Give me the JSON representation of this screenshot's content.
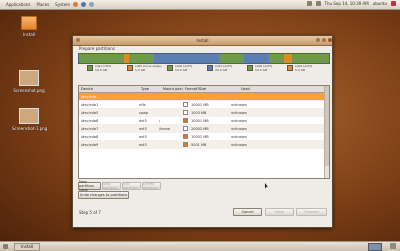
{
  "panel": {
    "menus": [
      "Applications",
      "Places",
      "System"
    ],
    "clock": "Thu Sep 14, 10:39 AM",
    "user": "ubuntu",
    "taskbar_item": "Install"
  },
  "desktop": {
    "icons": [
      {
        "label": "Install"
      },
      {
        "label": "Screenshot.png"
      },
      {
        "label": "Screenshot-1.png"
      }
    ]
  },
  "window": {
    "title": "Install",
    "section_label": "Prepare partitions",
    "partition_bar": {
      "segments": [
        {
          "color": "#6f9a4a",
          "fraction": 0.18
        },
        {
          "color": "#e08a2c",
          "fraction": 0.02
        },
        {
          "color": "#6f9a4a",
          "fraction": 0.1
        },
        {
          "color": "#5b7fb3",
          "fraction": 0.26
        },
        {
          "color": "#6f9a4a",
          "fraction": 0.1
        },
        {
          "color": "#5b7fb3",
          "fraction": 0.1
        },
        {
          "color": "#6f9a4a",
          "fraction": 0.06
        },
        {
          "color": "#e08a2c",
          "fraction": 0.03
        },
        {
          "color": "#6f9a4a",
          "fraction": 0.15
        }
      ]
    },
    "legend": [
      {
        "color": "#6f9a4a",
        "label": "sda1 (ntfs)",
        "size": "10.0 GB"
      },
      {
        "color": "#e08a2c",
        "label": "sda5 (linux-swap)",
        "size": "1.0 GB"
      },
      {
        "color": "#6f9a4a",
        "label": "sda6 (ext3)",
        "size": "10.0 GB"
      },
      {
        "color": "#5b7fb3",
        "label": "sda7 (ext3)",
        "size": "20.0 GB"
      },
      {
        "color": "#6f9a4a",
        "label": "sda8 (ext3)",
        "size": "10.0 GB"
      },
      {
        "color": "#e08a2c",
        "label": "sda9 (ext3)",
        "size": "5.0 GB"
      }
    ],
    "columns": [
      "Device",
      "Type",
      "Mount point",
      "Format?",
      "Size",
      "Used"
    ],
    "rows": [
      {
        "device": "/dev/sda",
        "type": "",
        "mount": "",
        "format": false,
        "size": "",
        "used": "",
        "selected": true
      },
      {
        "device": "/dev/sda1",
        "type": "ntfs",
        "mount": "",
        "format": false,
        "size": "10001 MB",
        "used": "unknown"
      },
      {
        "device": "/dev/sda5",
        "type": "swap",
        "mount": "",
        "format": false,
        "size": "1003 MB",
        "used": "unknown"
      },
      {
        "device": "/dev/sda6",
        "type": "ext3",
        "mount": "/",
        "format": true,
        "size": "10001 MB",
        "used": "unknown"
      },
      {
        "device": "/dev/sda7",
        "type": "ext3",
        "mount": "/home",
        "format": false,
        "size": "20002 MB",
        "used": "unknown"
      },
      {
        "device": "/dev/sda8",
        "type": "ext3",
        "mount": "",
        "format": true,
        "size": "10001 MB",
        "used": "unknown"
      },
      {
        "device": "/dev/sda9",
        "type": "ext3",
        "mount": "",
        "format": true,
        "size": "5001 MB",
        "used": "unknown"
      }
    ],
    "buttons": {
      "new_table": "New partition table",
      "new": "New partition",
      "edit": "Edit partition",
      "delete": "Delete partition",
      "undo": "Undo changes to partitions",
      "cancel": "Cancel",
      "back": "Back",
      "forward": "Forward"
    },
    "step_text": "Step 5 of 7"
  }
}
